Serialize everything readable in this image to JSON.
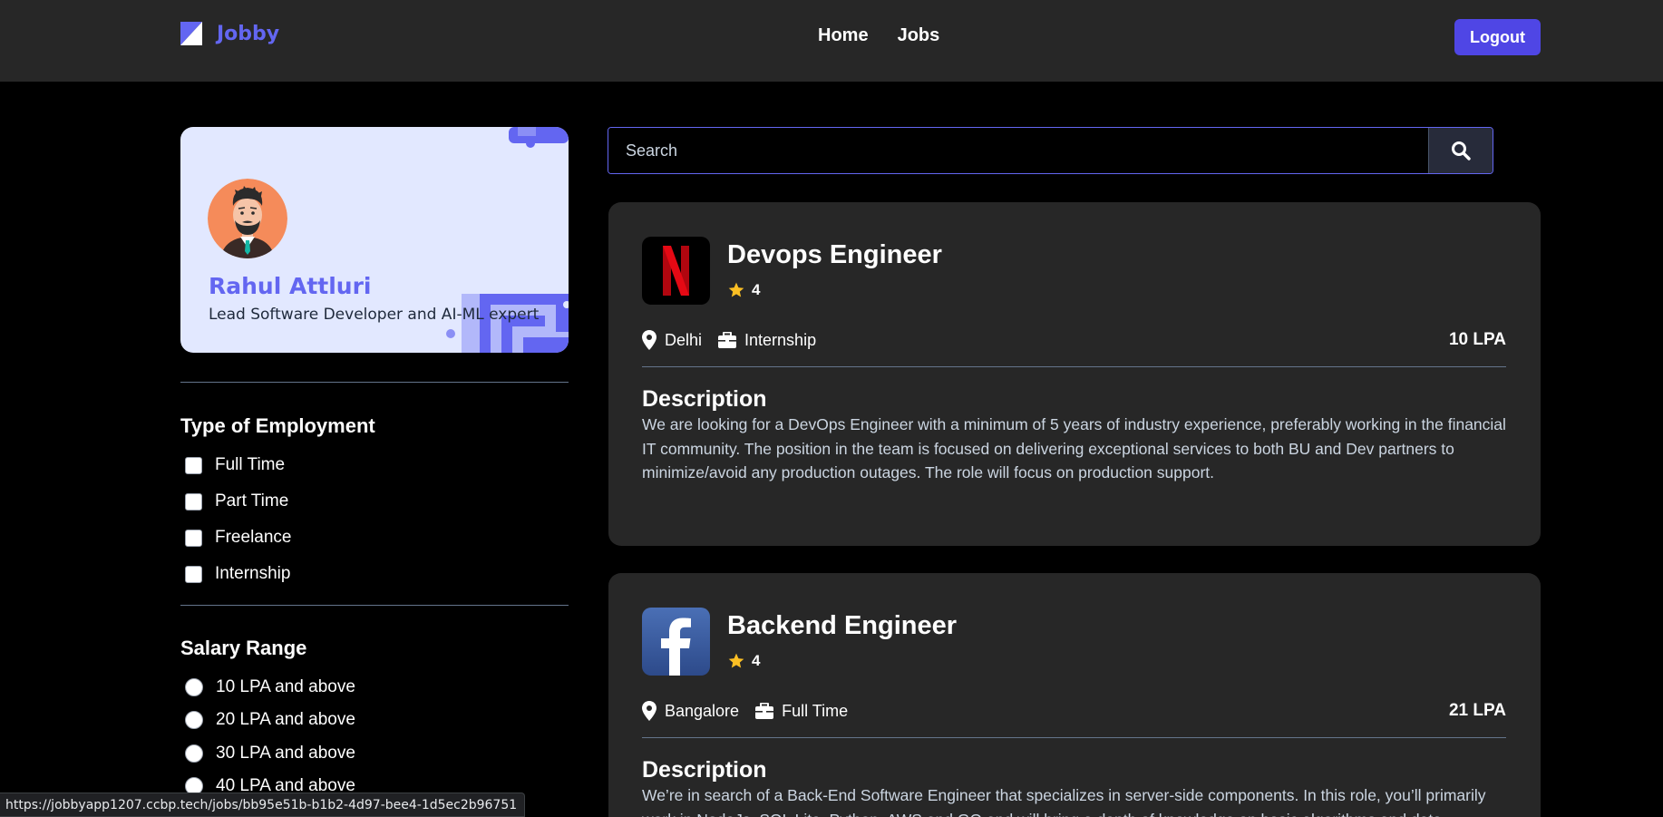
{
  "navbar": {
    "logo_text": "Jobby",
    "links": [
      "Home",
      "Jobs"
    ],
    "logout_label": "Logout"
  },
  "profile": {
    "name": "Rahul Attluri",
    "bio": "Lead Software Developer and AI-ML expert"
  },
  "employment_filter": {
    "title": "Type of Employment",
    "options": [
      "Full Time",
      "Part Time",
      "Freelance",
      "Internship"
    ]
  },
  "salary_filter": {
    "title": "Salary Range",
    "options": [
      "10 LPA and above",
      "20 LPA and above",
      "30 LPA and above",
      "40 LPA and above"
    ]
  },
  "search": {
    "placeholder": "Search"
  },
  "jobs": [
    {
      "title": "Devops Engineer",
      "rating": "4",
      "location": "Delhi",
      "employment_type": "Internship",
      "package": "10 LPA",
      "description_heading": "Description",
      "description": "We are looking for a DevOps Engineer with a minimum of 5 years of industry experience, preferably working in the financial IT community. The position in the team is focused on delivering exceptional services to both BU and Dev partners to minimize/avoid any production outages. The role will focus on production support.",
      "logo_icon": "netflix-logo"
    },
    {
      "title": "Backend Engineer",
      "rating": "4",
      "location": "Bangalore",
      "employment_type": "Full Time",
      "package": "21 LPA",
      "description_heading": "Description",
      "description": "We’re in search of a Back-End Software Engineer that specializes in server-side components. In this role, you’ll primarily work in NodeJs, SQL Lite, Python, AWS and GO and will bring a depth of knowledge on basic algorithms and data",
      "logo_icon": "facebook-logo"
    }
  ],
  "status_bar": {
    "url": "https://jobbyapp1207.ccbp.tech/jobs/bb95e51b-b1b2-4d97-bee4-1d5ec2b96751"
  },
  "colors": {
    "accent": "#6366f1",
    "button": "#4f46e5",
    "card": "#272727",
    "star": "#fbbf24"
  }
}
